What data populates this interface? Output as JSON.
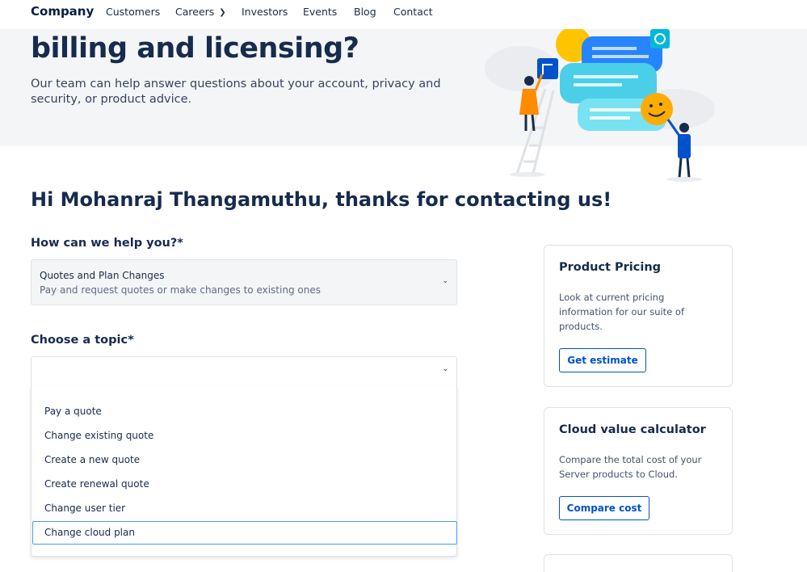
{
  "nav": {
    "brand": "Company",
    "items": [
      {
        "label": "Customers"
      },
      {
        "label": "Careers",
        "has_dropdown": true
      },
      {
        "label": "Investors"
      },
      {
        "label": "Events"
      },
      {
        "label": "Blog"
      },
      {
        "label": "Contact"
      }
    ]
  },
  "hero": {
    "title": "billing and licensing?",
    "subtitle": "Our team can help answer questions about your account, privacy and security, or product advice."
  },
  "greeting": "Hi Mohanraj Thangamuthu, thanks for contacting us!",
  "form": {
    "help_label": "How can we help you?*",
    "help_selected": {
      "title": "Quotes and Plan Changes",
      "description": "Pay and request quotes or make changes to existing ones"
    },
    "topic_label": "Choose a topic*",
    "topic_value": "",
    "topic_options": [
      "Pay a quote",
      "Change existing quote",
      "Create a new quote",
      "Create renewal quote",
      "Change user tier",
      "Change cloud plan"
    ],
    "topic_highlighted": "Change cloud plan"
  },
  "cards": [
    {
      "title": "Product Pricing",
      "text": "Look at current pricing information for our suite of products.",
      "button": "Get estimate"
    },
    {
      "title": "Cloud value calculator",
      "text": "Compare the total cost of your Server products to Cloud.",
      "button": "Compare cost"
    }
  ],
  "colors": {
    "accent": "#0052cc",
    "focus": "#4c9aff",
    "hero_bg": "#f4f5f7",
    "text": "#172b4d"
  },
  "icons": {
    "nav_dropdown": "chevron-down-icon",
    "select_dropdown": "chevron-down-icon"
  }
}
